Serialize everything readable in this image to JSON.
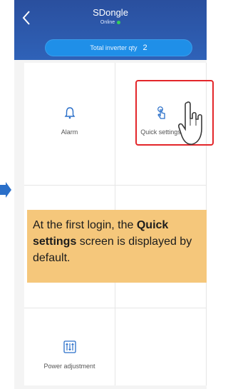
{
  "header": {
    "title": "SDongle",
    "status_label": "Online",
    "status_color": "#34d058"
  },
  "qty_pill": {
    "label": "Total inverter qty",
    "value": "2"
  },
  "tiles": [
    {
      "label": "Alarm",
      "icon": "bell-icon"
    },
    {
      "label": "Quick settings",
      "icon": "hand-touch-icon"
    },
    {
      "label": "",
      "icon": ""
    },
    {
      "label": "",
      "icon": ""
    },
    {
      "label": "Power adjustment",
      "icon": "sliders-icon"
    },
    {
      "label": "",
      "icon": ""
    }
  ],
  "note": {
    "text_before": "At the first login, the ",
    "bold": "Quick settings",
    "text_after": " screen is displayed by default."
  },
  "colors": {
    "header_blue": "#2f62b8",
    "pill_blue": "#1f8fe8",
    "highlight_red": "#e3262a",
    "note_bg": "#f5c77b",
    "arrow_blue": "#2a6fc9"
  }
}
